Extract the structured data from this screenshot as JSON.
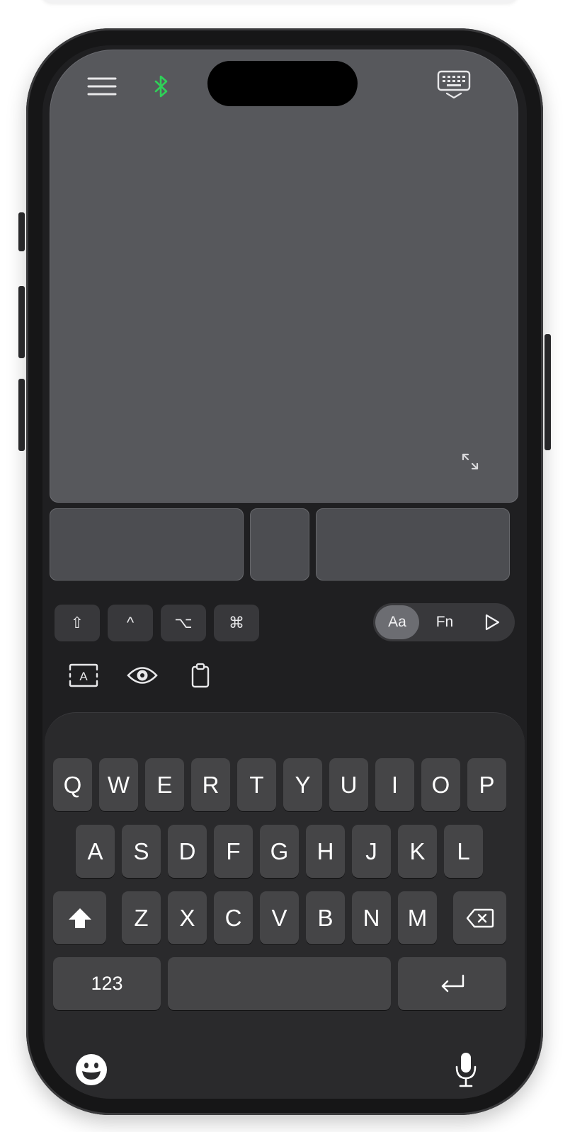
{
  "top_bar": {
    "menu_icon": "hamburger-menu-icon",
    "bluetooth_icon": "bluetooth-icon",
    "keyboard_toggle_icon": "keyboard-hide-icon",
    "bluetooth_color": "#2fd158"
  },
  "trackpad": {
    "expand_icon": "expand-arrows-icon"
  },
  "modifiers": [
    {
      "name": "shift",
      "symbol": "⇧"
    },
    {
      "name": "control",
      "symbol": "^"
    },
    {
      "name": "option",
      "symbol": "⌥"
    },
    {
      "name": "command",
      "symbol": "⌘"
    }
  ],
  "mode_switch": {
    "options": [
      "Aa",
      "Fn"
    ],
    "selected": "Aa",
    "play_icon": "play-icon"
  },
  "tools": [
    "text-input-icon",
    "eye-icon",
    "clipboard-icon"
  ],
  "keyboard": {
    "row1": [
      "Q",
      "W",
      "E",
      "R",
      "T",
      "Y",
      "U",
      "I",
      "O",
      "P"
    ],
    "row2": [
      "A",
      "S",
      "D",
      "F",
      "G",
      "H",
      "J",
      "K",
      "L"
    ],
    "row3": [
      "Z",
      "X",
      "C",
      "V",
      "B",
      "N",
      "M"
    ],
    "numbers_label": "123",
    "shift_icon": "shift-filled-icon",
    "delete_icon": "delete-backspace-icon",
    "return_icon": "return-icon",
    "emoji_icon": "emoji-icon",
    "mic_icon": "microphone-icon"
  }
}
